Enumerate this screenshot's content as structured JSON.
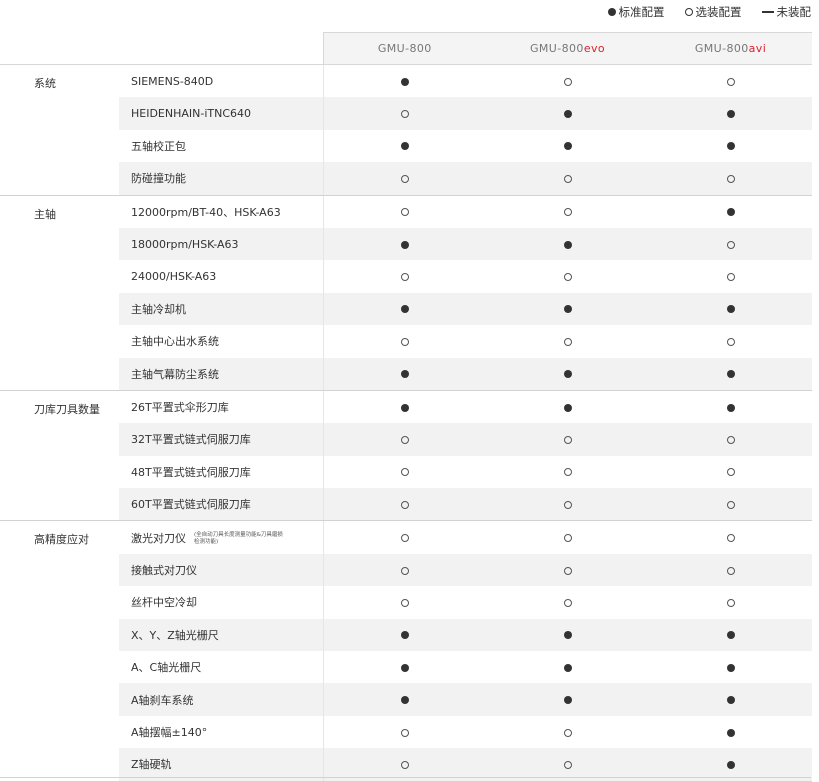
{
  "legend": {
    "standard": "标准配置",
    "optional": "选装配置",
    "none": "未装配"
  },
  "models": [
    {
      "base": "GMU-800",
      "suffix": ""
    },
    {
      "base": "GMU-800",
      "suffix": "evo"
    },
    {
      "base": "GMU-800",
      "suffix": "avi"
    }
  ],
  "colors": {
    "accent": "#d9232d",
    "alt_row": "#f2f2f2",
    "header_bg": "#f4f4f4",
    "text": "#333333"
  },
  "groups": [
    {
      "category": "系统",
      "rows": [
        {
          "feature": "SIEMENS-840D",
          "marks": [
            "std",
            "opt",
            "opt"
          ]
        },
        {
          "feature": "HEIDENHAIN-iTNC640",
          "marks": [
            "opt",
            "std",
            "std"
          ]
        },
        {
          "feature": "五轴校正包",
          "marks": [
            "std",
            "std",
            "std"
          ]
        },
        {
          "feature": "防碰撞功能",
          "marks": [
            "opt",
            "opt",
            "opt"
          ]
        }
      ]
    },
    {
      "category": "主轴",
      "rows": [
        {
          "feature": "12000rpm/BT-40、HSK-A63",
          "marks": [
            "opt",
            "opt",
            "std"
          ]
        },
        {
          "feature": "18000rpm/HSK-A63",
          "marks": [
            "std",
            "std",
            "opt"
          ]
        },
        {
          "feature": "24000/HSK-A63",
          "marks": [
            "opt",
            "opt",
            "opt"
          ]
        },
        {
          "feature": "主轴冷却机",
          "marks": [
            "std",
            "std",
            "std"
          ]
        },
        {
          "feature": "主轴中心出水系统",
          "marks": [
            "opt",
            "opt",
            "opt"
          ]
        },
        {
          "feature": "主轴气幕防尘系统",
          "marks": [
            "std",
            "std",
            "std"
          ]
        }
      ]
    },
    {
      "category": "刀库刀具数量",
      "rows": [
        {
          "feature": "26T平置式伞形刀库",
          "marks": [
            "std",
            "std",
            "std"
          ]
        },
        {
          "feature": "32T平置式链式伺服刀库",
          "marks": [
            "opt",
            "opt",
            "opt"
          ]
        },
        {
          "feature": "48T平置式链式伺服刀库",
          "marks": [
            "opt",
            "opt",
            "opt"
          ]
        },
        {
          "feature": "60T平置式链式伺服刀库",
          "marks": [
            "opt",
            "opt",
            "opt"
          ]
        }
      ]
    },
    {
      "category": "高精度应对",
      "rows": [
        {
          "feature": "激光对刀仪",
          "note": "(全自动刀具长度测量功能&刀具磨损检测功能)",
          "marks": [
            "opt",
            "opt",
            "opt"
          ]
        },
        {
          "feature": "接触式对刀仪",
          "marks": [
            "opt",
            "opt",
            "opt"
          ]
        },
        {
          "feature": "丝杆中空冷却",
          "marks": [
            "opt",
            "opt",
            "opt"
          ]
        },
        {
          "feature": "X、Y、Z轴光栅尺",
          "marks": [
            "std",
            "std",
            "std"
          ]
        },
        {
          "feature": "A、C轴光栅尺",
          "marks": [
            "std",
            "std",
            "std"
          ]
        },
        {
          "feature": "A轴刹车系统",
          "marks": [
            "std",
            "std",
            "std"
          ]
        },
        {
          "feature": "A轴摆幅±140°",
          "marks": [
            "opt",
            "opt",
            "std"
          ]
        },
        {
          "feature": "Z轴硬轨",
          "marks": [
            "opt",
            "opt",
            "std"
          ]
        }
      ]
    }
  ]
}
